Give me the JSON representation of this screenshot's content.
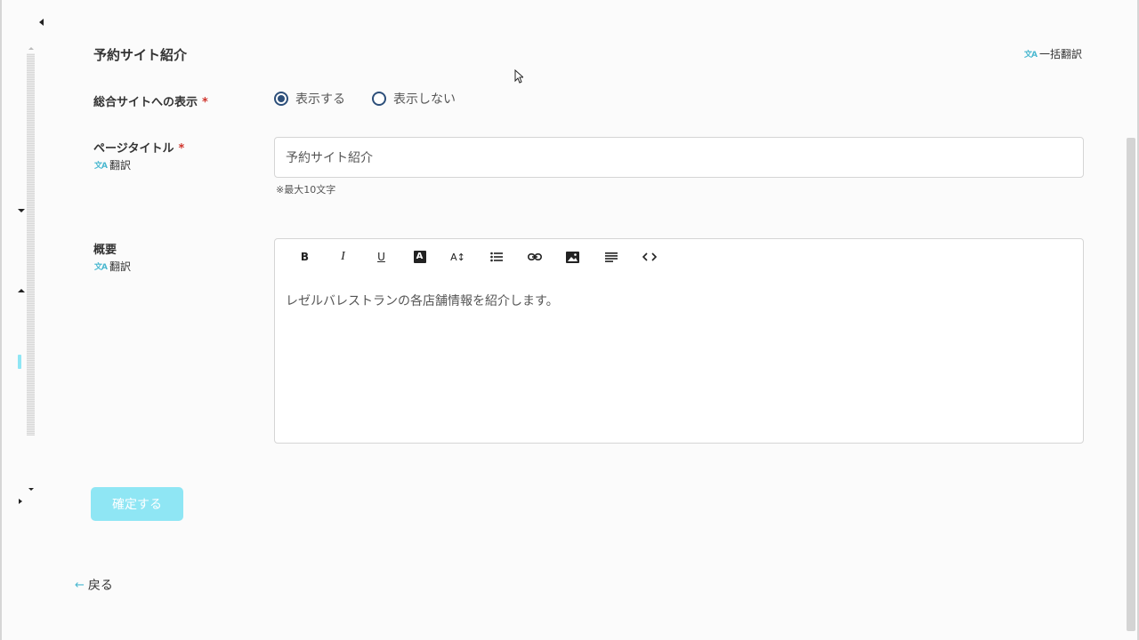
{
  "section": {
    "title": "予約サイト紹介",
    "bulk_translate_label": "一括翻訳"
  },
  "display_field": {
    "label": "総合サイトへの表示",
    "required_mark": "*",
    "options": [
      {
        "label": "表示する",
        "selected": true
      },
      {
        "label": "表示しない",
        "selected": false
      }
    ]
  },
  "title_field": {
    "label": "ページタイトル",
    "required_mark": "*",
    "translate_label": "翻訳",
    "value": "予約サイト紹介",
    "hint": "※最大10文字"
  },
  "summary_field": {
    "label": "概要",
    "translate_label": "翻訳",
    "toolbar": [
      "bold",
      "italic",
      "underline",
      "font-color",
      "font-size",
      "bulleted-list",
      "link",
      "image",
      "align",
      "code"
    ],
    "toolbar_glyphs": {
      "bold": "B",
      "italic": "I",
      "underline": "U",
      "font_color": "A",
      "font_size": "A↕"
    },
    "content": "レゼルバレストランの各店舗情報を紹介します。"
  },
  "confirm_button_label": "確定する",
  "back_link_label": "戻る",
  "icons": {
    "translate": "translate-icon",
    "back": "arrow-left-icon"
  },
  "colors": {
    "accent": "#8fe6f4",
    "radio": "#2d4f7a",
    "required": "#d0342c",
    "translate_icon": "#4ab8d0"
  }
}
